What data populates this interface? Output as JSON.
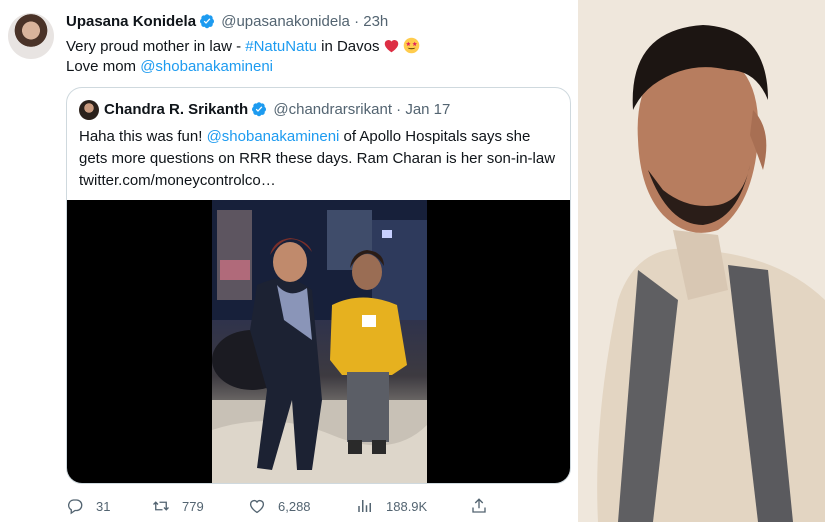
{
  "tweet": {
    "author_name": "Upasana Konidela",
    "handle": "@upasanakonidela",
    "time": "23h",
    "text_line1": "Very proud mother in law - ",
    "hashtag": "#NatuNatu",
    "text_line1_end": " in Davos",
    "text_line2": "Love mom ",
    "mention": "@shobanakamineni"
  },
  "quoted": {
    "author_name": "Chandra R. Srikanth",
    "handle": "@chandrarsrikant",
    "date": "Jan 17",
    "text_line1_start": "Haha this was fun! ",
    "mention": "@shobanakamineni",
    "text_line1_end": " of Apollo Hospitals says she",
    "text_line2": "gets more questions on RRR these days. Ram Charan is her son-in-law",
    "link": "twitter.com/moneycontrolco…"
  },
  "actions": {
    "replies": "31",
    "retweets": "779",
    "likes": "6,288",
    "views": "188.9K"
  },
  "icons": [
    "verified-badge-icon",
    "heart-emoji-icon",
    "star-struck-emoji-icon",
    "reply-icon",
    "retweet-icon",
    "like-icon",
    "views-icon",
    "share-icon"
  ],
  "colors": {
    "link": "#1d9bf0",
    "muted": "#536471",
    "verified": "#1d9bf0"
  }
}
